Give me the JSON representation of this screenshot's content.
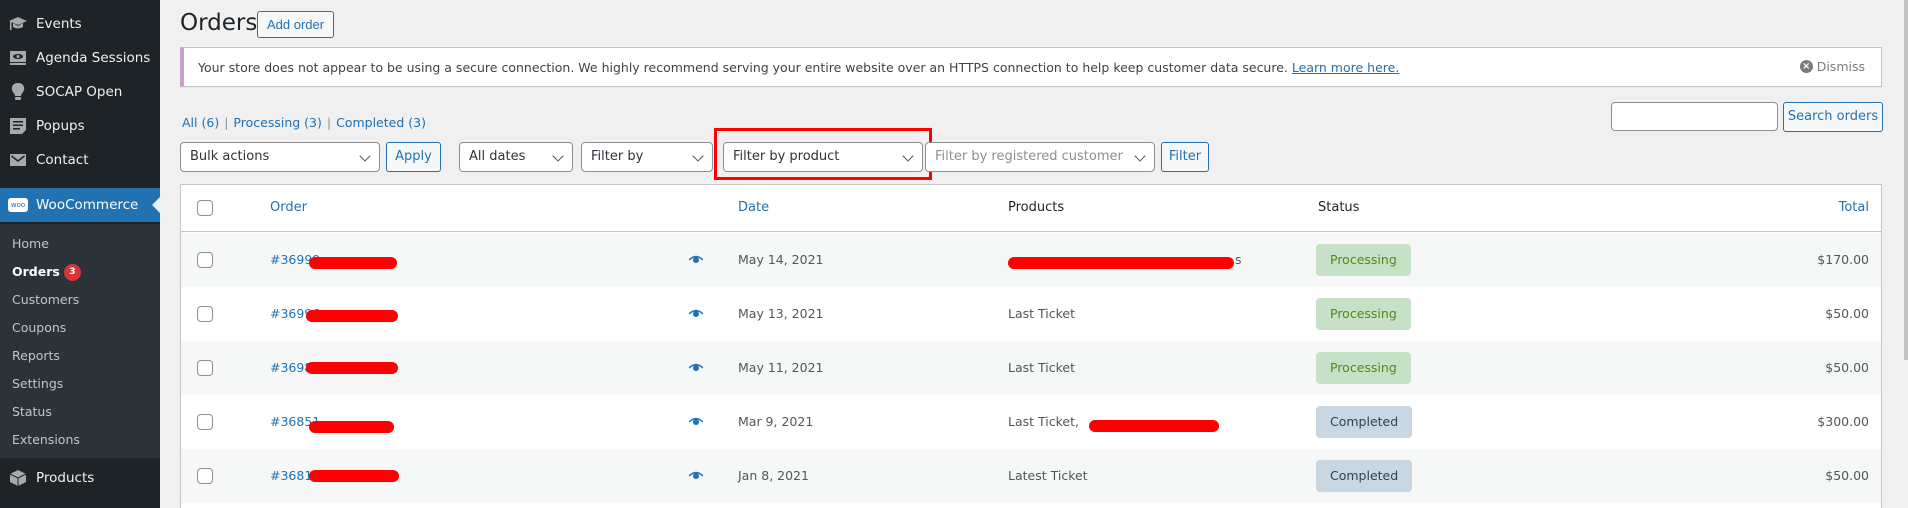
{
  "sidebar": {
    "items": [
      {
        "label": "Events",
        "icon": "graduation-cap-icon"
      },
      {
        "label": "Agenda Sessions",
        "icon": "monitor-eye-icon"
      },
      {
        "label": "SOCAP Open",
        "icon": "lightbulb-icon"
      },
      {
        "label": "Popups",
        "icon": "popup-icon"
      },
      {
        "label": "Contact",
        "icon": "envelope-icon"
      }
    ],
    "woocommerce": {
      "label": "WooCommerce",
      "icon": "woo-logo-icon",
      "logo_text": "woo"
    },
    "submenu": [
      {
        "label": "Home"
      },
      {
        "label": "Orders",
        "badge": "3",
        "current": true
      },
      {
        "label": "Customers"
      },
      {
        "label": "Coupons"
      },
      {
        "label": "Reports"
      },
      {
        "label": "Settings"
      },
      {
        "label": "Status"
      },
      {
        "label": "Extensions"
      }
    ],
    "products": {
      "label": "Products",
      "icon": "box-icon"
    }
  },
  "header": {
    "title": "Orders",
    "add_order_label": "Add order"
  },
  "notice": {
    "text": "Your store does not appear to be using a secure connection. We highly recommend serving your entire website over an HTTPS connection to help keep customer data secure.",
    "link": "Learn more here.",
    "dismiss": "Dismiss"
  },
  "status_filters": [
    {
      "label": "All",
      "count": "(6)"
    },
    {
      "label": "Processing",
      "count": "(3)"
    },
    {
      "label": "Completed",
      "count": "(3)"
    }
  ],
  "search": {
    "value": "",
    "button": "Search orders"
  },
  "filters": {
    "bulk_actions": "Bulk actions",
    "apply": "Apply",
    "dates": "All dates",
    "filter_by": "Filter by",
    "filter_by_product": "Filter by product",
    "filter_by_customer_placeholder": "Filter by registered customer",
    "filter_button": "Filter"
  },
  "table": {
    "columns": {
      "order": "Order",
      "date": "Date",
      "products": "Products",
      "status": "Status",
      "total": "Total"
    },
    "rows": [
      {
        "order": "#36999",
        "date": "May 14, 2021",
        "products": "",
        "products_suffix": "s",
        "status": "Processing",
        "status_key": "processing",
        "total": "$170.00"
      },
      {
        "order": "#36996",
        "date": "May 13, 2021",
        "products": "Last Ticket",
        "status": "Processing",
        "status_key": "processing",
        "total": "$50.00"
      },
      {
        "order": "#36988",
        "date": "May 11, 2021",
        "products": "Last Ticket",
        "status": "Processing",
        "status_key": "processing",
        "total": "$50.00"
      },
      {
        "order": "#36851",
        "date": "Mar 9, 2021",
        "products": "Last Ticket,",
        "status": "Completed",
        "status_key": "completed",
        "total": "$300.00"
      },
      {
        "order": "#36811",
        "date": "Jan 8, 2021",
        "products": "Latest Ticket",
        "status": "Completed",
        "status_key": "completed",
        "total": "$50.00"
      }
    ]
  },
  "colors": {
    "accent": "#2271b1",
    "sidebar_bg": "#1d2327",
    "processing_bg": "#c6e1c6",
    "completed_bg": "#c8d7e1",
    "highlight": "#ff0000"
  }
}
